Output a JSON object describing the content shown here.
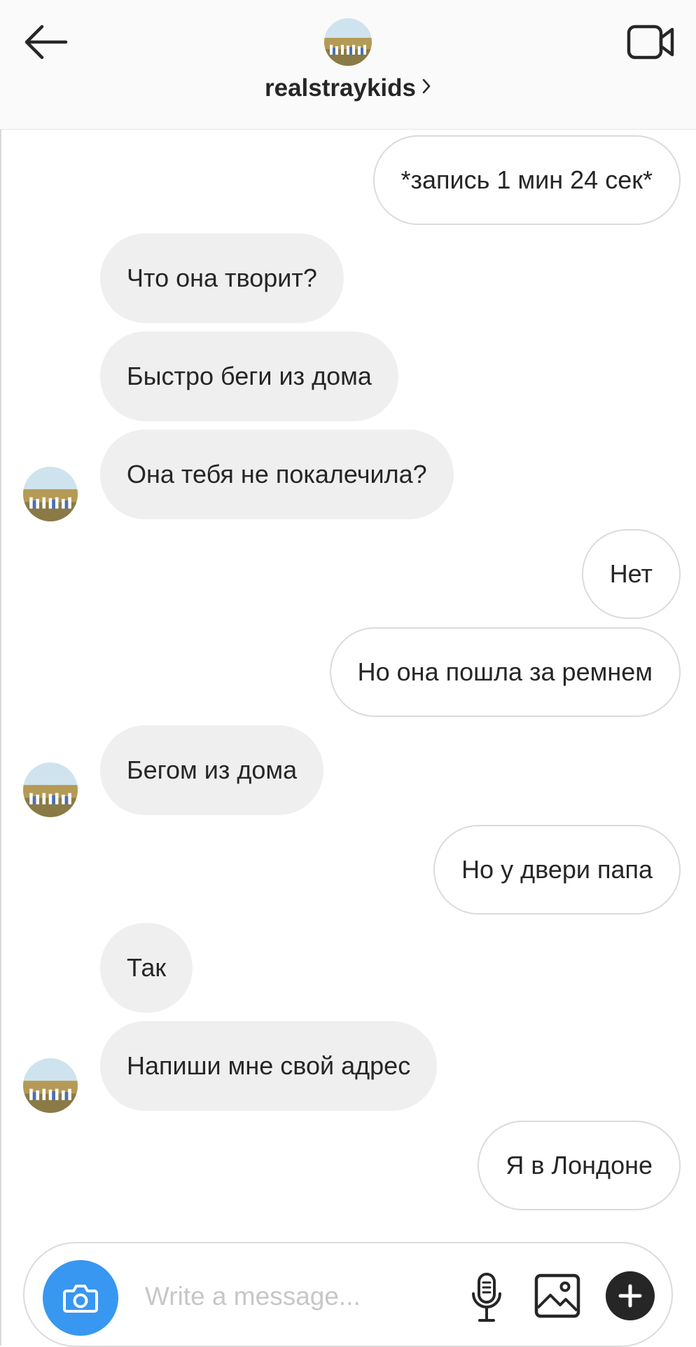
{
  "header": {
    "username": "realstraykids"
  },
  "messages": [
    {
      "dir": "out",
      "text": "*запись 1 мин 24 сек*"
    },
    {
      "dir": "in",
      "text": "Что она творит?"
    },
    {
      "dir": "in",
      "text": "Быстро беги из дома"
    },
    {
      "dir": "in",
      "text": "Она тебя не покалечила?"
    },
    {
      "dir": "out",
      "text": "Нет"
    },
    {
      "dir": "out",
      "text": "Но она пошла за ремнем"
    },
    {
      "dir": "in",
      "text": "Бегом из дома"
    },
    {
      "dir": "out",
      "text": "Но у двери папа"
    },
    {
      "dir": "in",
      "text": "Так"
    },
    {
      "dir": "in",
      "text": "Напиши мне свой адрес"
    },
    {
      "dir": "out",
      "text": "Я в Лондоне"
    }
  ],
  "composer": {
    "placeholder": "Write a message...",
    "value": ""
  },
  "icons": {
    "back": "arrow-left-icon",
    "video": "video-camera-icon",
    "camera": "camera-icon",
    "mic": "microphone-icon",
    "gallery": "image-icon",
    "plus": "plus-circle-icon"
  },
  "colors": {
    "accent": "#3897f0",
    "incoming_bubble": "#efefef",
    "outgoing_border": "#dbdbdb",
    "text": "#262626",
    "placeholder": "#c7c7c7"
  }
}
